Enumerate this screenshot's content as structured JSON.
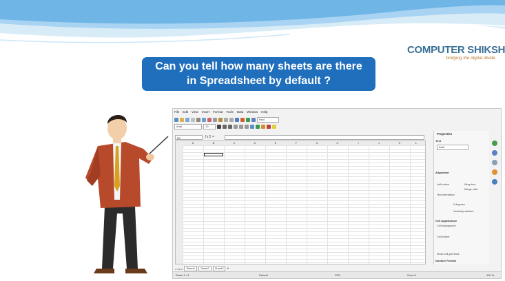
{
  "question": {
    "line1": "Can you tell how many sheets are there",
    "line2": "in Spreadsheet by default ?"
  },
  "logo": {
    "name": "COMPUTER SHIKSHA",
    "tagline": "bridging the digital divide"
  },
  "app": {
    "menus": [
      "File",
      "Edit",
      "View",
      "Insert",
      "Format",
      "Tools",
      "Data",
      "Window",
      "Help"
    ],
    "font_name": "Arial",
    "font_size": "10",
    "find_placeholder": "Find",
    "name_box": "B3",
    "columns": [
      "A",
      "B",
      "C",
      "D",
      "E",
      "F",
      "G",
      "H",
      "I",
      "J",
      "K",
      "L",
      "M"
    ],
    "sheet_tabs": [
      "Sheet1",
      "Sheet2",
      "Sheet3"
    ],
    "status": {
      "sheet": "Sheet 1 / 3",
      "style": "Default",
      "lang": "STD",
      "sum": "Sum=0",
      "zoom": "100 %"
    },
    "panel": {
      "title": "Properties",
      "sections": [
        "Text",
        "Alignment",
        "Cell Appearance",
        "Number Format"
      ],
      "labels": [
        "Left indent",
        "Wrap text",
        "Merge cells",
        "Text orientation",
        "0 degrees",
        "Vertically stacked",
        "Cell background",
        "Cell border",
        "Show cell grid lines"
      ]
    }
  },
  "colors": {
    "question_bg": "#1f6fbd",
    "logo_blue": "#3a6f96",
    "swoosh": "#8ec3ea"
  }
}
